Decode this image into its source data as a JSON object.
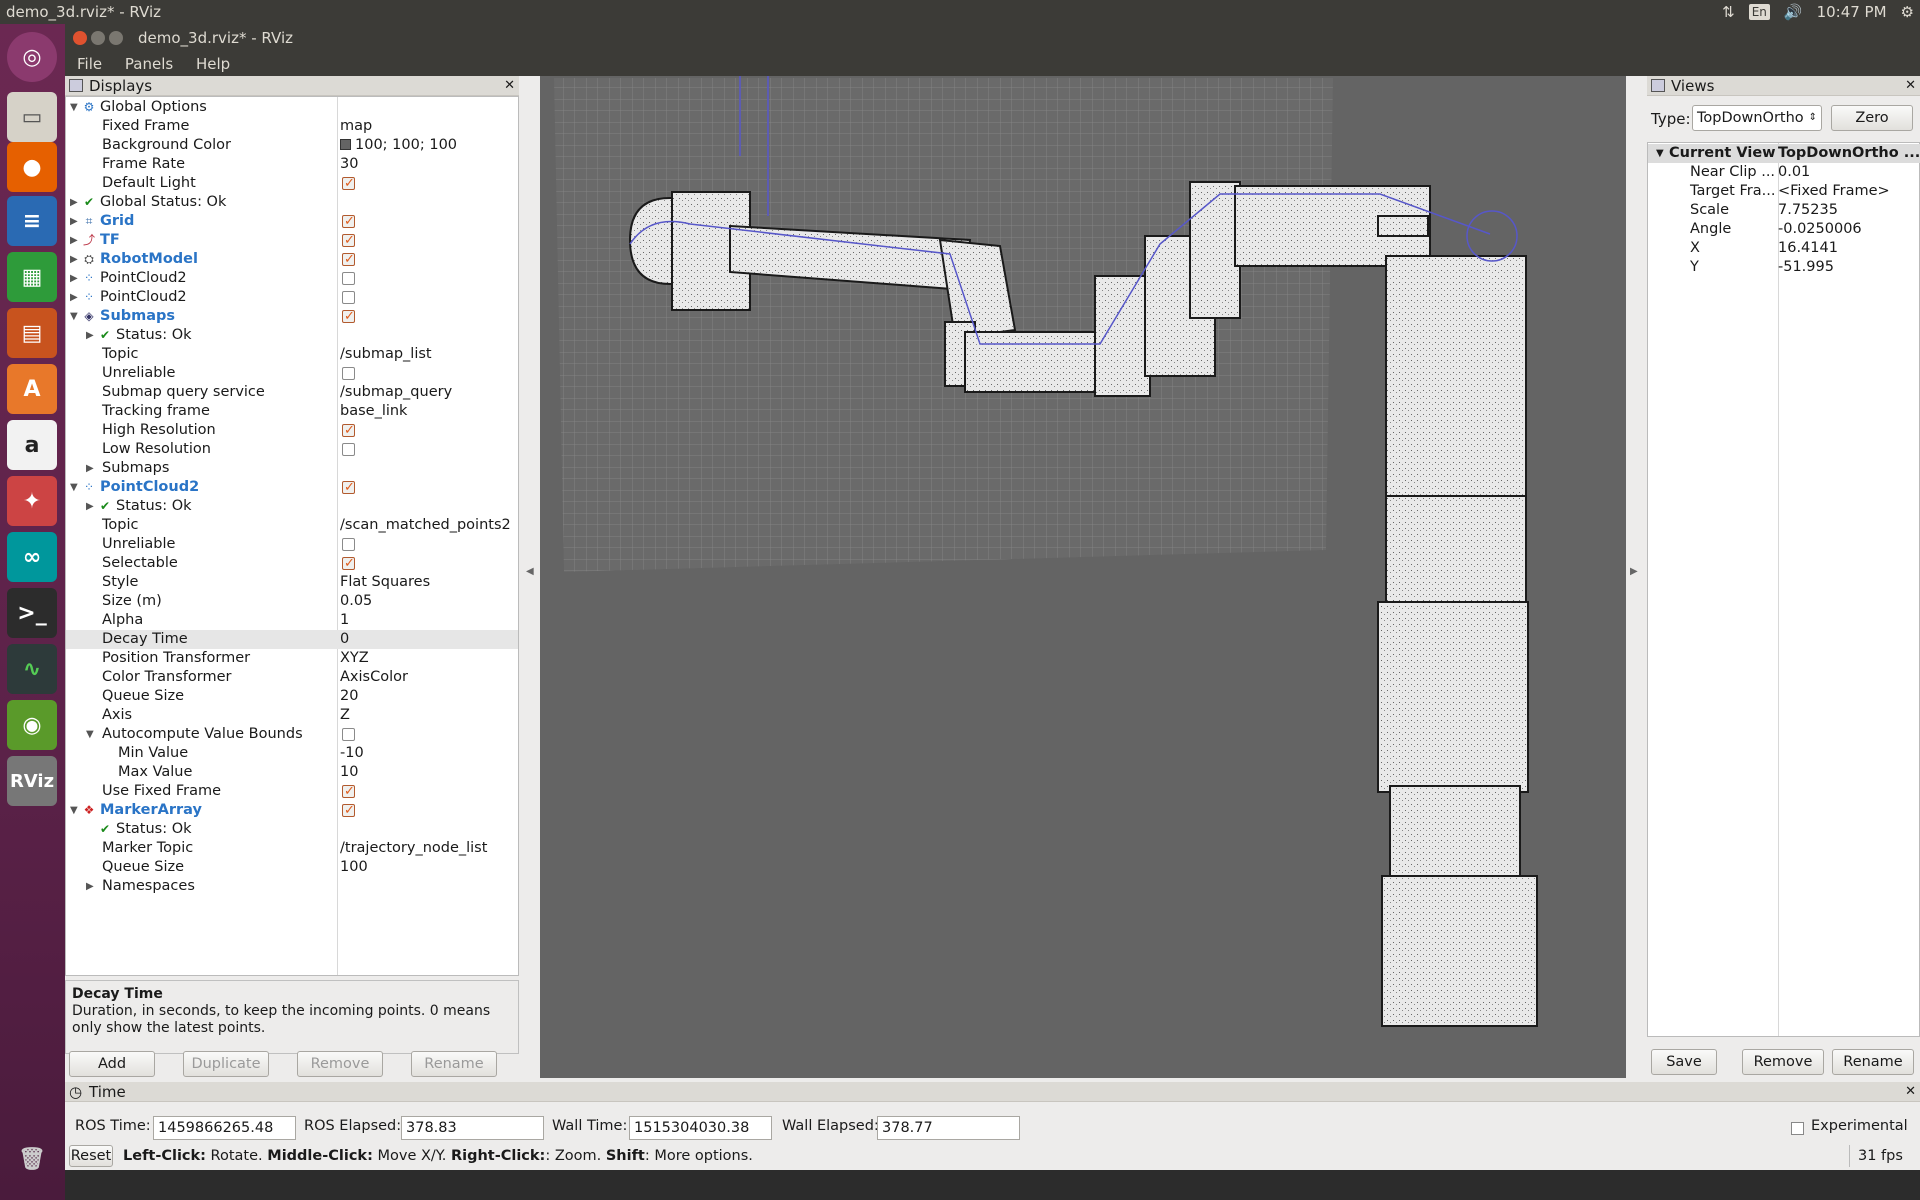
{
  "system": {
    "window_title": "demo_3d.rviz* - RViz",
    "tray_lang": "En",
    "clock": "10:47 PM"
  },
  "window": {
    "title": "demo_3d.rviz* - RViz"
  },
  "menu": {
    "file": "File",
    "panels": "Panels",
    "help": "Help"
  },
  "launcher": [
    "ubuntu-icon",
    "files-icon",
    "firefox-icon",
    "writer-icon",
    "calc-icon",
    "impress-icon",
    "software-center-icon",
    "amazon-icon",
    "settings-icon",
    "arduino-icon",
    "terminal-icon",
    "system-monitor-icon",
    "nvidia-icon",
    "rviz-icon",
    "trash-icon"
  ],
  "displays": {
    "title": "Displays",
    "rows": [
      {
        "label": "Global Options",
        "value": "",
        "indent": 0,
        "arrow": "▼",
        "icon": "gear"
      },
      {
        "label": "Fixed Frame",
        "value": "map",
        "indent": 1
      },
      {
        "label": "Background Color",
        "value": "100; 100; 100",
        "indent": 1,
        "swatch": true
      },
      {
        "label": "Frame Rate",
        "value": "30",
        "indent": 1
      },
      {
        "label": "Default Light",
        "value": "",
        "indent": 1,
        "check": true
      },
      {
        "label": "Global Status: Ok",
        "value": "",
        "indent": 0,
        "arrow": "▶",
        "icon": "ok"
      },
      {
        "label": "Grid",
        "value": "",
        "indent": 0,
        "arrow": "▶",
        "icon": "grid",
        "blue": true,
        "check": true
      },
      {
        "label": "TF",
        "value": "",
        "indent": 0,
        "arrow": "▶",
        "icon": "tf",
        "blue": true,
        "check": true
      },
      {
        "label": "RobotModel",
        "value": "",
        "indent": 0,
        "arrow": "▶",
        "icon": "robot",
        "blue": true,
        "check": true
      },
      {
        "label": "PointCloud2",
        "value": "",
        "indent": 0,
        "arrow": "▶",
        "icon": "cloud",
        "check": false
      },
      {
        "label": "PointCloud2",
        "value": "",
        "indent": 0,
        "arrow": "▶",
        "icon": "cloud",
        "check": false
      },
      {
        "label": "Submaps",
        "value": "",
        "indent": 0,
        "arrow": "▼",
        "icon": "submap",
        "blue": true,
        "check": true
      },
      {
        "label": "Status: Ok",
        "value": "",
        "indent": 1,
        "arrow": "▶",
        "icon": "ok"
      },
      {
        "label": "Topic",
        "value": "/submap_list",
        "indent": 1
      },
      {
        "label": "Unreliable",
        "value": "",
        "indent": 1,
        "check": false
      },
      {
        "label": "Submap query service",
        "value": "/submap_query",
        "indent": 1
      },
      {
        "label": "Tracking frame",
        "value": "base_link",
        "indent": 1
      },
      {
        "label": "High Resolution",
        "value": "",
        "indent": 1,
        "check": true
      },
      {
        "label": "Low Resolution",
        "value": "",
        "indent": 1,
        "check": false
      },
      {
        "label": "Submaps",
        "value": "",
        "indent": 1,
        "arrow": "▶"
      },
      {
        "label": "PointCloud2",
        "value": "",
        "indent": 0,
        "arrow": "▼",
        "icon": "cloud",
        "blue": true,
        "check": true
      },
      {
        "label": "Status: Ok",
        "value": "",
        "indent": 1,
        "arrow": "▶",
        "icon": "ok"
      },
      {
        "label": "Topic",
        "value": "/scan_matched_points2",
        "indent": 1
      },
      {
        "label": "Unreliable",
        "value": "",
        "indent": 1,
        "check": false
      },
      {
        "label": "Selectable",
        "value": "",
        "indent": 1,
        "check": true
      },
      {
        "label": "Style",
        "value": "Flat Squares",
        "indent": 1
      },
      {
        "label": "Size (m)",
        "value": "0.05",
        "indent": 1
      },
      {
        "label": "Alpha",
        "value": "1",
        "indent": 1
      },
      {
        "label": "Decay Time",
        "value": "0",
        "indent": 1,
        "selected": true
      },
      {
        "label": "Position Transformer",
        "value": "XYZ",
        "indent": 1
      },
      {
        "label": "Color Transformer",
        "value": "AxisColor",
        "indent": 1
      },
      {
        "label": "Queue Size",
        "value": "20",
        "indent": 1
      },
      {
        "label": "Axis",
        "value": "Z",
        "indent": 1
      },
      {
        "label": "Autocompute Value Bounds",
        "value": "",
        "indent": 1,
        "arrow": "▼",
        "check": false
      },
      {
        "label": "Min Value",
        "value": "-10",
        "indent": 2
      },
      {
        "label": "Max Value",
        "value": "10",
        "indent": 2
      },
      {
        "label": "Use Fixed Frame",
        "value": "",
        "indent": 1,
        "check": true
      },
      {
        "label": "MarkerArray",
        "value": "",
        "indent": 0,
        "arrow": "▼",
        "icon": "marker",
        "blue": true,
        "check": true
      },
      {
        "label": "Status: Ok",
        "value": "",
        "indent": 1,
        "icon": "ok"
      },
      {
        "label": "Marker Topic",
        "value": "/trajectory_node_list",
        "indent": 1
      },
      {
        "label": "Queue Size",
        "value": "100",
        "indent": 1
      },
      {
        "label": "Namespaces",
        "value": "",
        "indent": 1,
        "arrow": "▶"
      }
    ],
    "description": {
      "heading": "Decay Time",
      "text": "Duration, in seconds, to keep the incoming points. 0 means only show the latest points."
    },
    "buttons": {
      "add": "Add",
      "duplicate": "Duplicate",
      "remove": "Remove",
      "rename": "Rename"
    }
  },
  "views": {
    "title": "Views",
    "type_label": "Type:",
    "type_value": "TopDownOrtho",
    "zero": "Zero",
    "header_name": "Current View",
    "header_value": "TopDownOrtho ...",
    "rows": [
      {
        "label": "Near Clip ...",
        "value": "0.01"
      },
      {
        "label": "Target Fra...",
        "value": "<Fixed Frame>"
      },
      {
        "label": "Scale",
        "value": "7.75235"
      },
      {
        "label": "Angle",
        "value": "-0.0250006"
      },
      {
        "label": "X",
        "value": "16.4141"
      },
      {
        "label": "Y",
        "value": "-51.995"
      }
    ],
    "buttons": {
      "save": "Save",
      "remove": "Remove",
      "rename": "Rename"
    }
  },
  "time": {
    "title": "Time",
    "ros_time_label": "ROS Time:",
    "ros_time": "1459866265.48",
    "ros_elapsed_label": "ROS Elapsed:",
    "ros_elapsed": "378.83",
    "wall_time_label": "Wall Time:",
    "wall_time": "1515304030.38",
    "wall_elapsed_label": "Wall Elapsed:",
    "wall_elapsed": "378.77",
    "experimental": "Experimental"
  },
  "status": {
    "reset": "Reset",
    "k1": "Left-Click:",
    "v1": " Rotate. ",
    "k2": "Middle-Click:",
    "v2": " Move X/Y. ",
    "k3": "Right-Click:",
    "v3": ": Zoom. ",
    "k4": "Shift",
    "v4": ": More options.",
    "fps": "31 fps"
  }
}
